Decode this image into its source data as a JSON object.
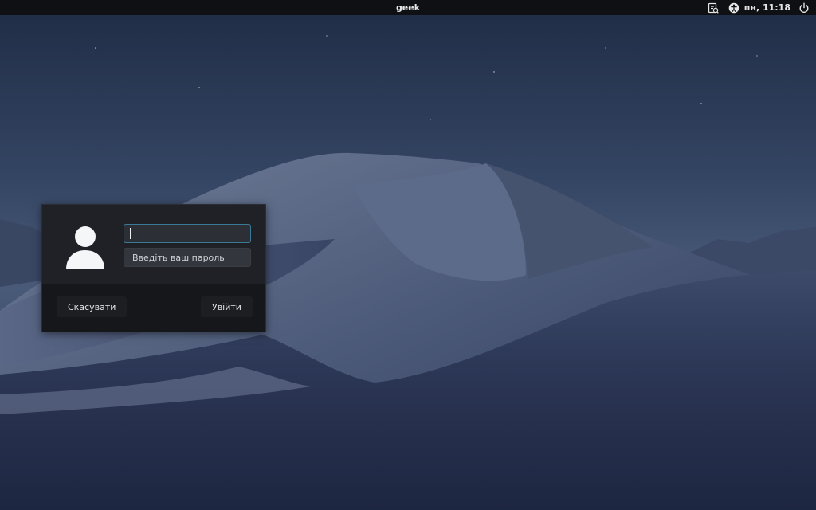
{
  "top_panel": {
    "title": "geek",
    "clock": "пн, 11:18",
    "icons": [
      "keyboard-layout-icon",
      "accessibility-icon",
      "power-icon"
    ]
  },
  "login_dialog": {
    "avatar": "user-avatar-icon",
    "username_value": "",
    "password_placeholder": "Введіть ваш пароль",
    "cancel_label": "Скасувати",
    "login_label": "Увійти"
  },
  "colors": {
    "panel_bg": "#0e1013",
    "dialog_bg": "#1f2126",
    "input_focus_border": "#3b7a94"
  }
}
